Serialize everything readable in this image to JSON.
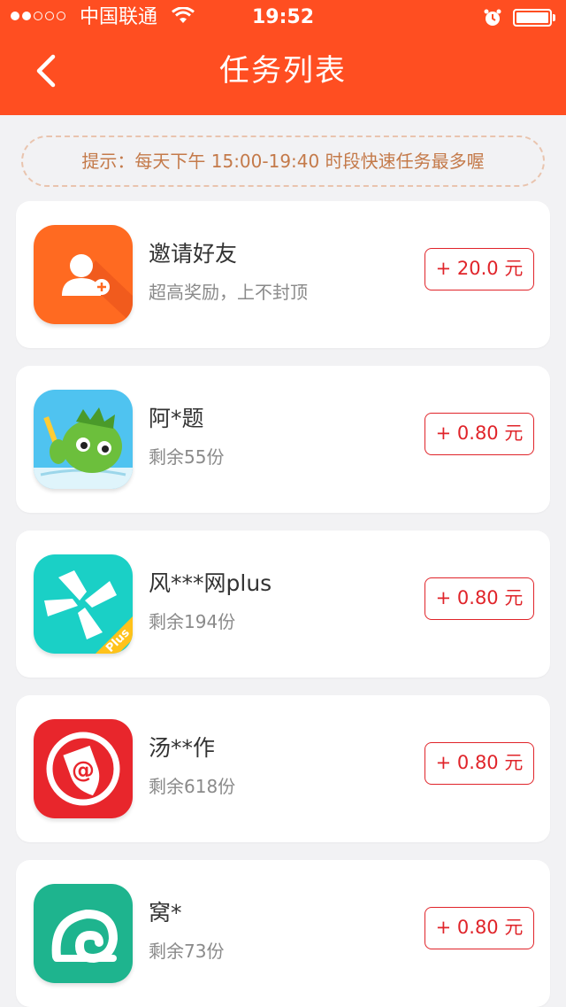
{
  "status_bar": {
    "carrier": "中国联通",
    "time": "19:52"
  },
  "nav": {
    "title": "任务列表"
  },
  "tip": "提示：每天下午 15:00-19:40 时段快速任务最多喔",
  "tasks": [
    {
      "title": "邀请好友",
      "subtitle": "超高奖励，上不封顶",
      "reward": "+ 20.0 元",
      "icon": "invite-friend-icon",
      "color": "#ff6a21"
    },
    {
      "title": "阿*题",
      "subtitle": "剩余55份",
      "reward": "+ 0.80 元",
      "icon": "dinosaur-app-icon",
      "color": "#4fc3f0"
    },
    {
      "title": "风***网plus",
      "subtitle": "剩余194份",
      "reward": "+ 0.80 元",
      "icon": "windmill-app-icon",
      "color": "#1ad0c6"
    },
    {
      "title": "汤**作",
      "subtitle": "剩余618份",
      "reward": "+ 0.80 元",
      "icon": "shield-at-app-icon",
      "color": "#e8262c"
    },
    {
      "title": "窝*",
      "subtitle": "剩余73份",
      "reward": "+ 0.80 元",
      "icon": "snail-app-icon",
      "color": "#1eb48e"
    }
  ]
}
